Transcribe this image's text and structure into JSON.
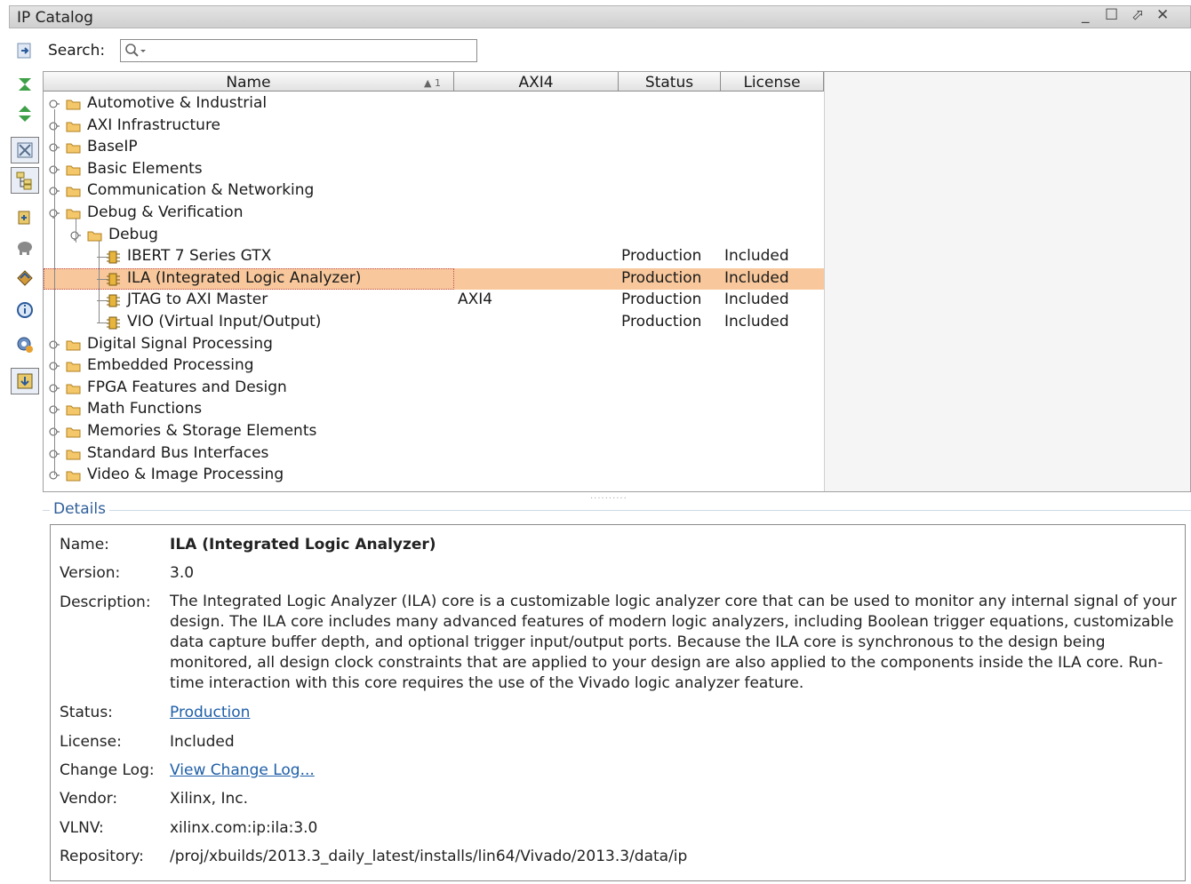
{
  "window": {
    "title": "IP Catalog",
    "minimize_glyph": "_",
    "maximize_glyph": "☐",
    "restore_glyph": "⬀",
    "close_glyph": "✕"
  },
  "toolbar": {
    "icons": [
      "collapse-all-icon",
      "expand-all-icon",
      "customize-icon",
      "show-hierarchy-icon",
      "add-repository-icon",
      "elephant-icon",
      "properties-icon",
      "info-icon",
      "settings-icon",
      "download-icon"
    ]
  },
  "search": {
    "label": "Search:",
    "placeholder": "",
    "value": ""
  },
  "table": {
    "columns": [
      "Name",
      "AXI4",
      "Status",
      "License"
    ],
    "sort_indicator": "▲ 1",
    "rows": [
      {
        "name": "Automotive & Industrial",
        "level": 0,
        "type": "folder",
        "axi": "",
        "status": "",
        "license": ""
      },
      {
        "name": "AXI Infrastructure",
        "level": 0,
        "type": "folder",
        "axi": "",
        "status": "",
        "license": ""
      },
      {
        "name": "BaseIP",
        "level": 0,
        "type": "folder",
        "axi": "",
        "status": "",
        "license": ""
      },
      {
        "name": "Basic Elements",
        "level": 0,
        "type": "folder",
        "axi": "",
        "status": "",
        "license": ""
      },
      {
        "name": "Communication & Networking",
        "level": 0,
        "type": "folder",
        "axi": "",
        "status": "",
        "license": ""
      },
      {
        "name": "Debug & Verification",
        "level": 0,
        "type": "folder-open",
        "axi": "",
        "status": "",
        "license": ""
      },
      {
        "name": "Debug",
        "level": 1,
        "type": "folder-open",
        "axi": "",
        "status": "",
        "license": ""
      },
      {
        "name": "IBERT 7 Series GTX",
        "level": 2,
        "type": "ip",
        "axi": "",
        "status": "Production",
        "license": "Included"
      },
      {
        "name": "ILA (Integrated Logic Analyzer)",
        "level": 2,
        "type": "ip",
        "axi": "",
        "status": "Production",
        "license": "Included",
        "selected": true
      },
      {
        "name": "JTAG to AXI Master",
        "level": 2,
        "type": "ip",
        "axi": "AXI4",
        "status": "Production",
        "license": "Included"
      },
      {
        "name": "VIO (Virtual Input/Output)",
        "level": 2,
        "type": "ip",
        "axi": "",
        "status": "Production",
        "license": "Included"
      },
      {
        "name": "Digital Signal Processing",
        "level": 0,
        "type": "folder",
        "axi": "",
        "status": "",
        "license": ""
      },
      {
        "name": "Embedded Processing",
        "level": 0,
        "type": "folder",
        "axi": "",
        "status": "",
        "license": ""
      },
      {
        "name": "FPGA Features and Design",
        "level": 0,
        "type": "folder",
        "axi": "",
        "status": "",
        "license": ""
      },
      {
        "name": "Math Functions",
        "level": 0,
        "type": "folder",
        "axi": "",
        "status": "",
        "license": ""
      },
      {
        "name": "Memories & Storage Elements",
        "level": 0,
        "type": "folder",
        "axi": "",
        "status": "",
        "license": ""
      },
      {
        "name": "Standard Bus Interfaces",
        "level": 0,
        "type": "folder",
        "axi": "",
        "status": "",
        "license": ""
      },
      {
        "name": "Video & Image Processing",
        "level": 0,
        "type": "folder",
        "axi": "",
        "status": "",
        "license": ""
      }
    ]
  },
  "splitter_glyph": "··········",
  "details": {
    "title": "Details",
    "fields": {
      "name_label": "Name:",
      "name_value": "ILA (Integrated Logic Analyzer)",
      "version_label": "Version:",
      "version_value": "3.0",
      "description_label": "Description:",
      "description_value": "The Integrated Logic Analyzer (ILA) core is a customizable logic analyzer core that can be used to monitor any internal signal of your design. The ILA core includes many advanced features of modern logic analyzers, including Boolean trigger equations, customizable data capture buffer depth, and optional trigger input/output ports.  Because the ILA core is synchronous to the design being monitored, all design clock constraints that are applied to your design are also applied to the components inside the ILA core. Run-time interaction with this core requires the use of the Vivado logic analyzer feature.",
      "status_label": "Status:",
      "status_value": "Production",
      "license_label": "License:",
      "license_value": "Included",
      "changelog_label": "Change Log:",
      "changelog_value": "View Change Log...",
      "vendor_label": "Vendor:",
      "vendor_value": "Xilinx, Inc.",
      "vlnv_label": "VLNV:",
      "vlnv_value": "xilinx.com:ip:ila:3.0",
      "repository_label": "Repository:",
      "repository_value": "/proj/xbuilds/2013.3_daily_latest/installs/lin64/Vivado/2013.3/data/ip"
    }
  },
  "colors": {
    "selection": "#f8c89c",
    "link": "#1f5fa8",
    "details_title": "#2f5f9a",
    "folder": "#f4c76a"
  }
}
